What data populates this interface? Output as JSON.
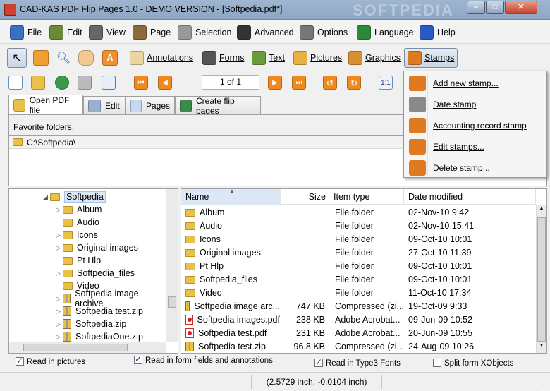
{
  "window": {
    "title": "CAD-KAS PDF Flip Pages 1.0 - DEMO VERSION - [Softpedia.pdf*]",
    "watermark": "SOFTPEDIA",
    "min": "–",
    "max": "□",
    "close": "✕"
  },
  "menu": [
    {
      "label": "File",
      "icon": "file-icon",
      "color": "#3a6fc4"
    },
    {
      "label": "Edit",
      "icon": "edit-icon",
      "color": "#6a8a3a"
    },
    {
      "label": "View",
      "icon": "view-icon",
      "color": "#666666"
    },
    {
      "label": "Page",
      "icon": "page-icon",
      "color": "#8a6a3a"
    },
    {
      "label": "Selection",
      "icon": "selection-icon",
      "color": "#999999"
    },
    {
      "label": "Advanced",
      "icon": "graduation-cap-icon",
      "color": "#333333"
    },
    {
      "label": "Options",
      "icon": "wrench-icon",
      "color": "#777777"
    },
    {
      "label": "Language",
      "icon": "globe-icon",
      "color": "#2a8a3a"
    },
    {
      "label": "Help",
      "icon": "help-icon",
      "color": "#2a5ac4"
    }
  ],
  "tools": {
    "annotations": "Annotations",
    "forms": "Forms",
    "text": "Text",
    "pictures": "Pictures",
    "graphics": "Graphics",
    "stamps": "Stamps"
  },
  "nav": {
    "page_indicator": "1 of 1",
    "zoom": "1:1"
  },
  "tabs": [
    "Open PDF file",
    "Edit",
    "Pages",
    "Create flip pages"
  ],
  "favorites": {
    "label": "Favorite folders:",
    "path": "C:\\Softpedia\\"
  },
  "tree": {
    "root": "Softpedia",
    "items": [
      "Album",
      "Audio",
      "Icons",
      "Original images",
      "Pt Hlp",
      "Softpedia_files",
      "Video",
      "Softpedia image archive",
      "Softpedia test.zip",
      "Softpedia.zip",
      "SoftpediaOne.zip"
    ]
  },
  "filelist": {
    "columns": [
      "Name",
      "Size",
      "Item type",
      "Date modified"
    ],
    "rows": [
      {
        "name": "Album",
        "size": "",
        "type": "File folder",
        "date": "02-Nov-10 9:42",
        "kind": "folder"
      },
      {
        "name": "Audio",
        "size": "",
        "type": "File folder",
        "date": "02-Nov-10 15:41",
        "kind": "folder"
      },
      {
        "name": "Icons",
        "size": "",
        "type": "File folder",
        "date": "09-Oct-10 10:01",
        "kind": "folder"
      },
      {
        "name": "Original images",
        "size": "",
        "type": "File folder",
        "date": "27-Oct-10 11:39",
        "kind": "folder"
      },
      {
        "name": "Pt Hlp",
        "size": "",
        "type": "File folder",
        "date": "09-Oct-10 10:01",
        "kind": "folder"
      },
      {
        "name": "Softpedia_files",
        "size": "",
        "type": "File folder",
        "date": "09-Oct-10 10:01",
        "kind": "folder"
      },
      {
        "name": "Video",
        "size": "",
        "type": "File folder",
        "date": "11-Oct-10 17:34",
        "kind": "folder"
      },
      {
        "name": "Softpedia image arc...",
        "size": "747 KB",
        "type": "Compressed (zi...",
        "date": "19-Oct-09 9:33",
        "kind": "zip"
      },
      {
        "name": "Softpedia images.pdf",
        "size": "238 KB",
        "type": "Adobe Acrobat...",
        "date": "09-Jun-09 10:52",
        "kind": "pdf"
      },
      {
        "name": "Softpedia test.pdf",
        "size": "231 KB",
        "type": "Adobe Acrobat...",
        "date": "20-Jun-09 10:55",
        "kind": "pdf"
      },
      {
        "name": "Softpedia test.zip",
        "size": "96.8 KB",
        "type": "Compressed (zi...",
        "date": "24-Aug-09 10:26",
        "kind": "zip"
      }
    ]
  },
  "stamps_menu": [
    {
      "label": "Add new stamp...",
      "icon": "add-icon",
      "color": "#e07a20"
    },
    {
      "label": "Date stamp",
      "icon": "calendar-icon",
      "color": "#8a8a8a"
    },
    {
      "label": "Accounting record stamp",
      "icon": "calculator-icon",
      "color": "#e07a20"
    },
    {
      "label": "Edit stamps...",
      "icon": "pencil-icon",
      "color": "#e07a20"
    },
    {
      "label": "Delete stamp...",
      "icon": "eraser-icon",
      "color": "#e07a20"
    }
  ],
  "options": {
    "read_pictures": "Read in pictures",
    "read_forms": "Read in form fields and annotations",
    "read_type3": "Read in Type3 Fonts",
    "split_xobjects": "Split form XObjects"
  },
  "status": {
    "coords": "(2.5729 inch, -0.0104 inch)"
  }
}
